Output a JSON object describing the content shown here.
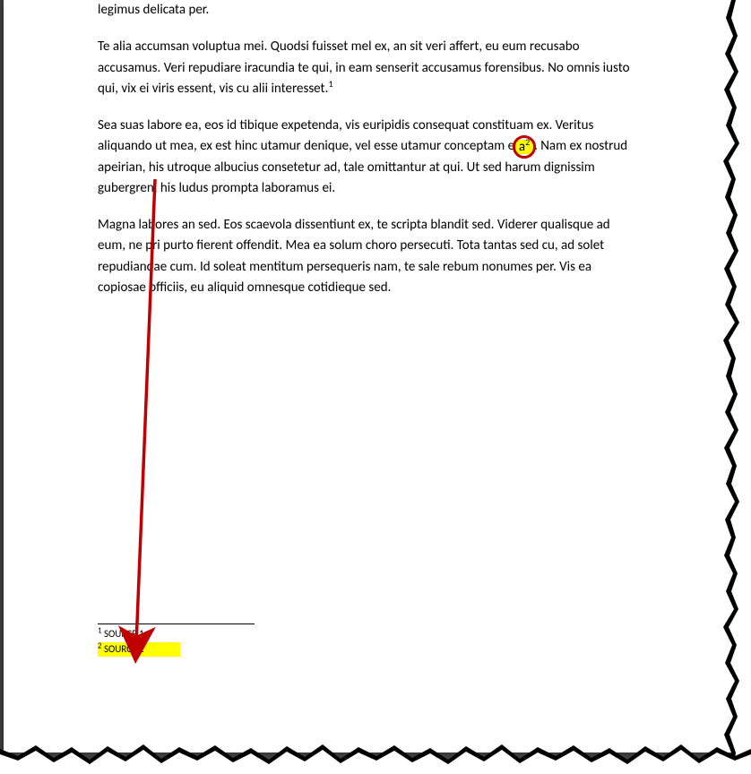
{
  "paragraphs": {
    "p0": "legimus delicata per.",
    "p1_a": "Te alia accumsan voluptua mei. Quodsi fuisset mel ex, an sit veri affert, eu eum recusabo accusamus. Veri repudiare iracundia te qui, in eam senserit accusamus forensibus. No omnis iusto qui, vix ei viris essent, vis cu alii interesset.",
    "p1_sup": "1",
    "p2_a": "Sea suas labore ea, eos id tibique expetenda, vis euripidis consequat constituam ex. Veritus aliquando ut mea, ex est hinc utamur denique, vel esse utamur conceptam e",
    "p2_inner": "a",
    "p2_sup": "2",
    "p2_b": ". Nam ex nostrud apeirian, his utroque albucius consetetur ad, tale omittantur at qui. Ut sed harum dignissim gubergren, his ludus prompta laboramus ei.",
    "p3": "Magna labores an sed. Eos scaevola dissentiunt ex, te scripta blandit sed. Viderer qualisque ad eum, ne pri purto fierent offendit. Mea ea solum choro persecuti. Tota tantas sed cu, ad solet repudiandae cum. Id soleat mentitum persequeris nam, te sale rebum nonumes per. Vis ea copiosae officiis, eu aliquid omnesque cotidieque sed."
  },
  "footnotes": {
    "f1_num": "1",
    "f1_text": " SOURCE 1",
    "f2_num": "2",
    "f2_text": " SOURCE 2"
  }
}
